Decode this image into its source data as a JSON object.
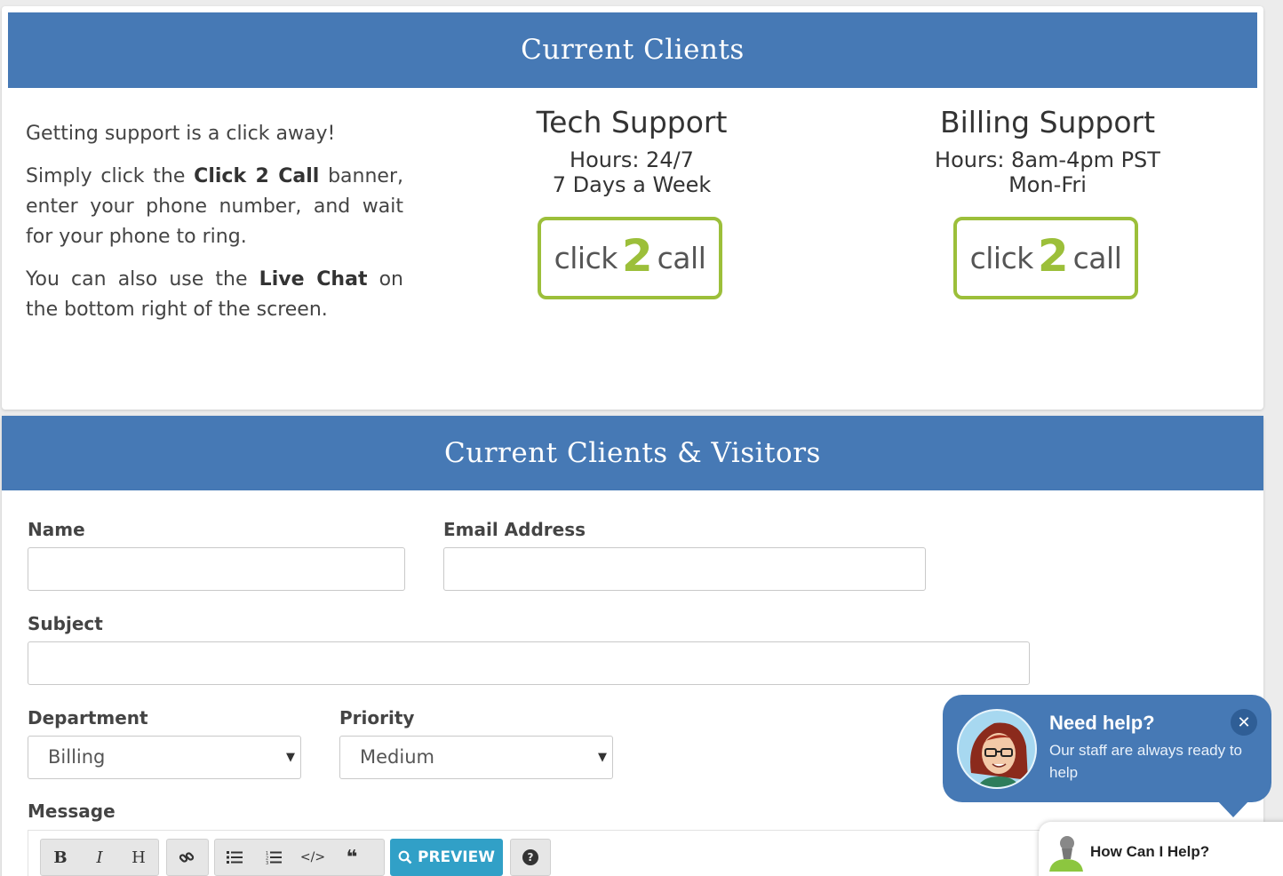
{
  "current_clients": {
    "title": "Current Clients",
    "intro_line": "Getting support is a click away!",
    "p2_pre": "Simply click the ",
    "p2_bold": "Click 2 Call",
    "p2_post": " banner, enter your phone number, and wait for your phone to ring.",
    "p3_pre": "You can also use the ",
    "p3_bold": "Live Chat",
    "p3_post": " on the bottom right of the screen.",
    "tech": {
      "title": "Tech Support",
      "hours_line1": "Hours: 24/7",
      "hours_line2": "7 Days a Week"
    },
    "billing": {
      "title": "Billing Support",
      "hours_line1": "Hours: 8am-4pm PST",
      "hours_line2": "Mon-Fri"
    },
    "click2call": {
      "word1": "click",
      "number": "2",
      "word2": "call",
      "accent": "#9cbf3a"
    }
  },
  "ticket_form": {
    "title": "Current Clients & Visitors",
    "name_label": "Name",
    "name_value": "",
    "email_label": "Email Address",
    "email_value": "",
    "subject_label": "Subject",
    "subject_value": "",
    "department_label": "Department",
    "department_value": "Billing",
    "priority_label": "Priority",
    "priority_value": "Medium",
    "message_label": "Message",
    "toolbar": {
      "bold": "B",
      "italic": "I",
      "heading": "H",
      "link_icon": "link-icon",
      "ul_icon": "list-ul-icon",
      "ol_icon": "list-ol-icon",
      "code": "</>",
      "quote": "❝",
      "preview_label": "PREVIEW",
      "help": "?"
    }
  },
  "chat_widget": {
    "title": "Need help?",
    "subtitle": "Our staff are always ready to help",
    "close": "✕",
    "launcher_label": "How Can I Help?"
  },
  "colors": {
    "banner": "#4679b5",
    "preview_button": "#31a0c7",
    "click2call": "#9cbf3a"
  }
}
